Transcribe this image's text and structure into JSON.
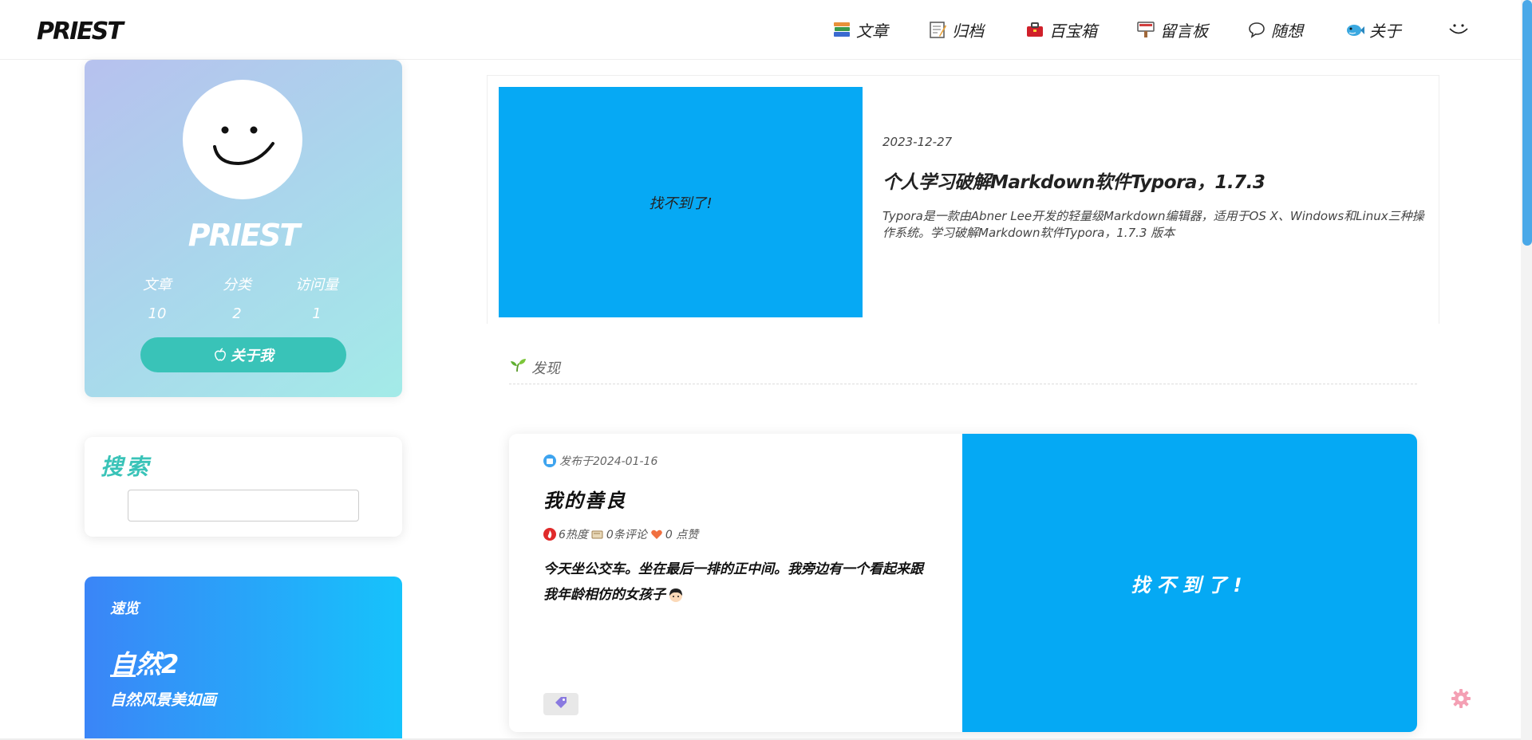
{
  "header": {
    "logo": "PRIEST",
    "nav": [
      {
        "label": "文章",
        "icon": "books-icon"
      },
      {
        "label": "归档",
        "icon": "memo-icon"
      },
      {
        "label": "百宝箱",
        "icon": "toolbox-icon"
      },
      {
        "label": "留言板",
        "icon": "signboard-icon"
      },
      {
        "label": "随想",
        "icon": "speech-bubble-icon"
      },
      {
        "label": "关于",
        "icon": "fish-icon"
      }
    ],
    "user_icon": "smile-icon"
  },
  "profile": {
    "name": "PRIEST",
    "stats": [
      {
        "label": "文章",
        "value": "10"
      },
      {
        "label": "分类",
        "value": "2"
      },
      {
        "label": "访问量",
        "value": "1"
      }
    ],
    "about_button": "关于我"
  },
  "search": {
    "title": "搜索",
    "placeholder": ""
  },
  "quick_view": {
    "label": "速览",
    "title_underlined": "自",
    "title_rest": "然2",
    "subtitle": "自然风景美如画"
  },
  "featured": {
    "image_text": "找不到了!",
    "date": "2023-12-27",
    "title": "个人学习破解Markdown软件Typora，1.7.3",
    "description": "Typora是一款由Abner Lee开发的轻量级Markdown编辑器，适用于OS X、Windows和Linux三种操作系统。学习破解Markdown软件Typora，1.7.3 版本"
  },
  "discover": {
    "label": "发现"
  },
  "post": {
    "published": "发布于2024-01-16",
    "title": "我的善良",
    "heat": "6热度",
    "comments": "0条评论",
    "likes": "0 点赞",
    "excerpt": "今天坐公交车。坐在最后一排的正中间。我旁边有一个看起来跟我年龄相仿的女孩子",
    "image_text": "找不到了!"
  },
  "colors": {
    "accent_teal": "#39c3b8",
    "image_blue": "#06a9f4",
    "quick_gradient_start": "#3b85f7",
    "quick_gradient_end": "#16c3fb"
  }
}
